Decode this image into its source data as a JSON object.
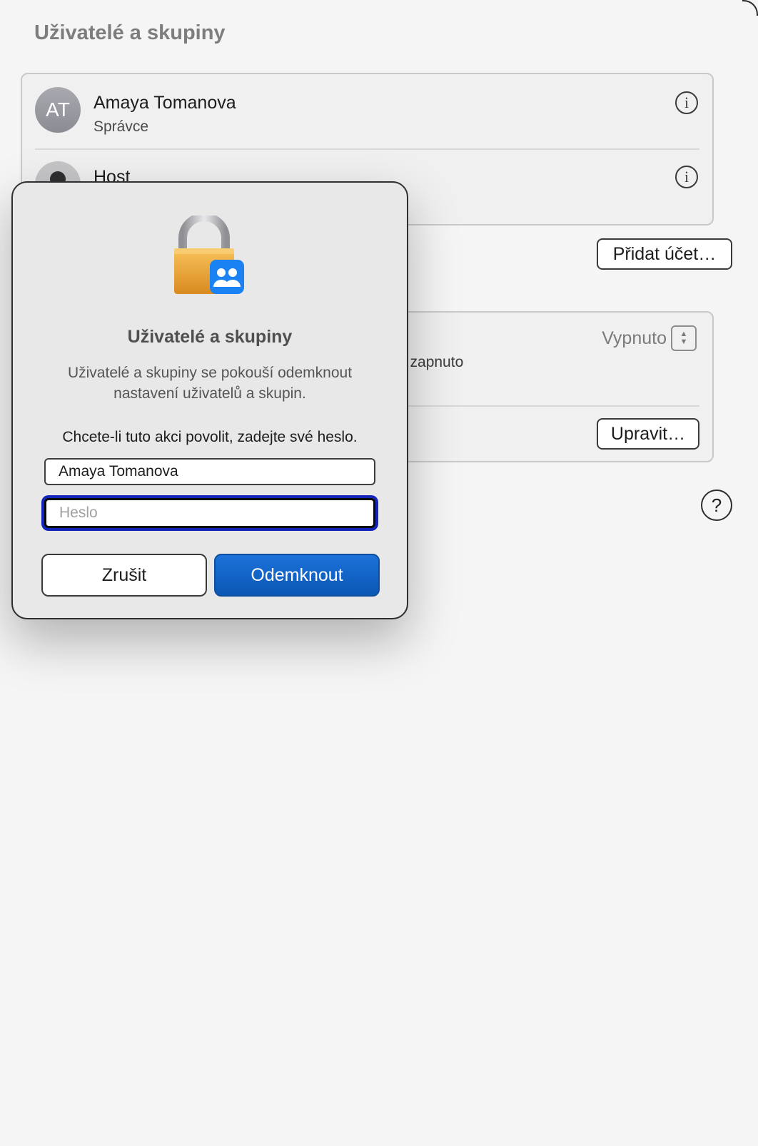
{
  "page": {
    "title": "Uživatelé a skupiny"
  },
  "users": [
    {
      "initials": "AT",
      "name": "Amaya Tomanova",
      "role": "Správce"
    },
    {
      "name": "Host"
    }
  ],
  "actions": {
    "add_account": "Přidat účet…",
    "edit": "Upravit…",
    "help": "?"
  },
  "setting": {
    "value": "Vypnuto",
    "desc_fragment": "e zapnuto"
  },
  "dialog": {
    "title": "Uživatelé a skupiny",
    "message": "Uživatelé a skupiny se pokouší odemknout nastavení uživatelů a skupin.",
    "prompt": "Chcete-li tuto akci povolit, zadejte své heslo.",
    "username_value": "Amaya Tomanova",
    "password_placeholder": "Heslo",
    "cancel_label": "Zrušit",
    "unlock_label": "Odemknout"
  },
  "icons": {
    "lock": "lock-icon",
    "badge": "users-badge-icon",
    "info": "info-icon",
    "stepper": "stepper-icon"
  },
  "colors": {
    "accent": "#0a5fc3",
    "focus_ring": "#1324b8"
  }
}
